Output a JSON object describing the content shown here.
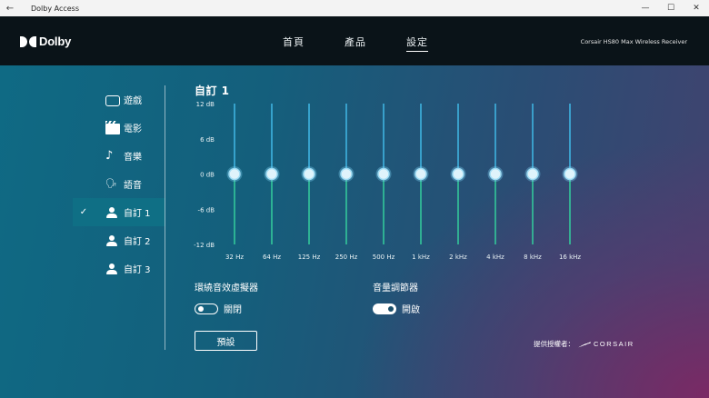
{
  "titlebar": {
    "back_icon": "back-arrow-icon",
    "title": "Dolby Access",
    "minimize": "—",
    "maximize": "☐",
    "close": "✕"
  },
  "header": {
    "logo_text": "Dolby",
    "nav": [
      "首頁",
      "產品",
      "設定"
    ],
    "active_nav": "設定",
    "device_name": "Corsair HS80 Max Wireless Receiver"
  },
  "sidebar": {
    "items": [
      {
        "label": "遊戲",
        "icon": "gamepad-icon",
        "active": false
      },
      {
        "label": "電影",
        "icon": "clapperboard-icon",
        "active": false
      },
      {
        "label": "音樂",
        "icon": "music-note-icon",
        "active": false
      },
      {
        "label": "語音",
        "icon": "voice-icon",
        "active": false
      },
      {
        "label": "自訂 1",
        "icon": "user-icon",
        "active": true
      },
      {
        "label": "自訂 2",
        "icon": "user-icon",
        "active": false
      },
      {
        "label": "自訂 3",
        "icon": "user-icon",
        "active": false
      }
    ]
  },
  "equalizer": {
    "title": "自訂 1",
    "db_labels": [
      "12 dB",
      "6 dB",
      "0 dB",
      "-6 dB",
      "-12 dB"
    ],
    "bands": [
      "32 Hz",
      "64 Hz",
      "125 Hz",
      "250 Hz",
      "500 Hz",
      "1 kHz",
      "2 kHz",
      "4 kHz",
      "8 kHz",
      "16 kHz"
    ],
    "gains_db": [
      0,
      0,
      0,
      0,
      0,
      0,
      0,
      0,
      0,
      0
    ],
    "range_db": [
      -12,
      12
    ],
    "colors": {
      "upper": "#3fb3e0",
      "lower": "#33c79a",
      "knob": "#dff3fb",
      "glow": "#7fd3f5"
    }
  },
  "surround": {
    "label": "環繞音效虛擬器",
    "state": "關閉",
    "on": false
  },
  "volume_leveler": {
    "label": "音量調節器",
    "state": "開啟",
    "on": true
  },
  "preset_button": "預設",
  "provided_by": {
    "label": "提供授權者：",
    "brand": "CORSAIR"
  }
}
